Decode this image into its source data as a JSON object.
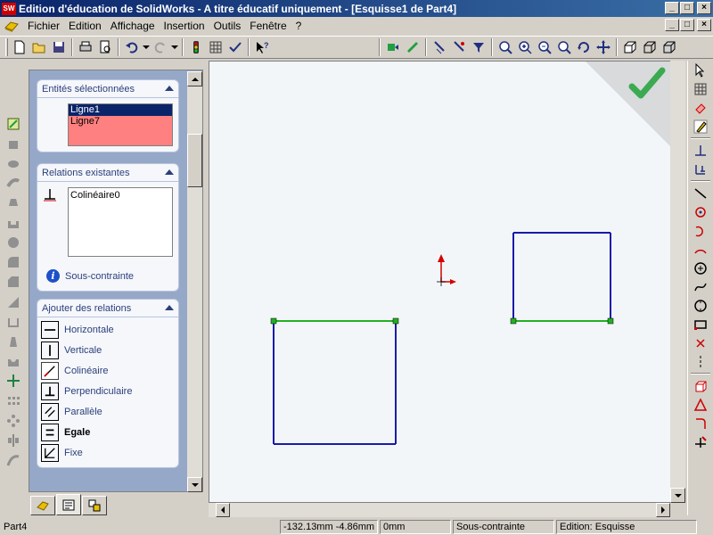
{
  "window": {
    "app_icon": "SW",
    "title": "Edition d'éducation de SolidWorks - A titre éducatif uniquement - [Esquisse1 de Part4]"
  },
  "menu": {
    "items": [
      "Fichier",
      "Edition",
      "Affichage",
      "Insertion",
      "Outils",
      "Fenêtre",
      "?"
    ]
  },
  "panel": {
    "selected": {
      "header": "Entités sélectionnées",
      "items": [
        "Ligne1",
        "Ligne7"
      ],
      "list_color": "#ff8080",
      "active_color": "#0a246a"
    },
    "existing": {
      "header": "Relations existantes",
      "items": [
        "Colinéaire0"
      ],
      "status": "Sous-contrainte"
    },
    "add": {
      "header": "Ajouter des relations",
      "items": [
        {
          "label": "Horizontale",
          "icon": "horizontal-icon"
        },
        {
          "label": "Verticale",
          "icon": "vertical-icon"
        },
        {
          "label": "Colinéaire",
          "icon": "collinear-icon"
        },
        {
          "label": "Perpendiculaire",
          "icon": "perpendicular-icon"
        },
        {
          "label": "Parallèle",
          "icon": "parallel-icon"
        },
        {
          "label": "Egale",
          "icon": "equal-icon"
        },
        {
          "label": "Fixe",
          "icon": "fix-icon"
        }
      ]
    }
  },
  "sketch": {
    "line_color": "#1a1aa8",
    "selected_line_color": "#22b022",
    "point_color": "#22b022",
    "origin_color": "#d40000",
    "confirm_color": "#3caa50"
  },
  "status": {
    "document": "Part4",
    "coords": "-132.13mm -4.86mm",
    "z": "0mm",
    "constraint": "Sous-contrainte",
    "mode": "Edition: Esquisse"
  }
}
